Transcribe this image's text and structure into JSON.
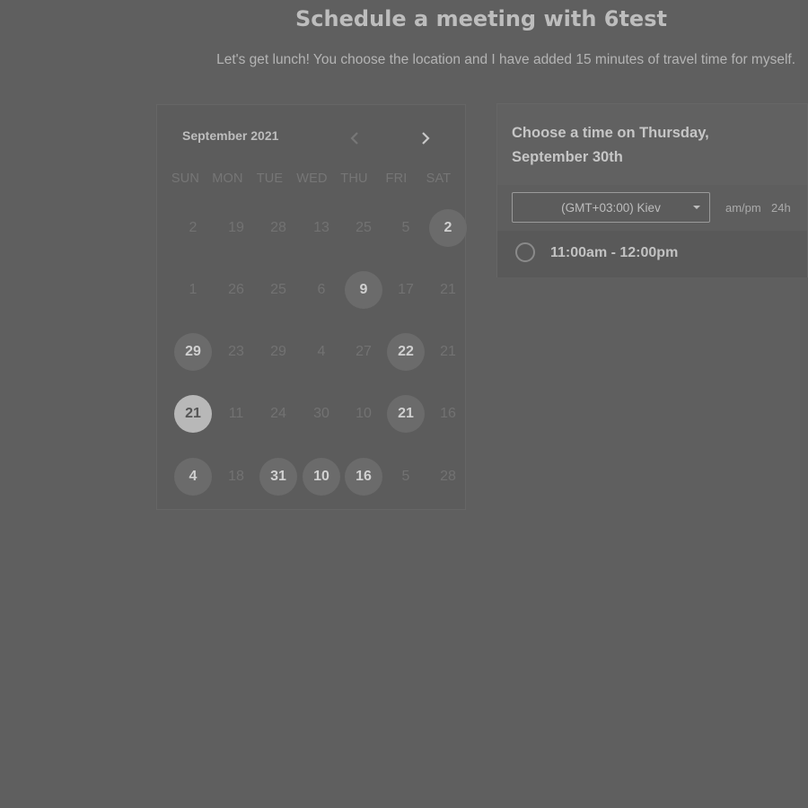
{
  "page": {
    "title": "Schedule a meeting with 6test",
    "subtitle": "Let's get lunch! You choose the location and I have added 15 minutes of travel time for myself."
  },
  "calendar": {
    "month_label": "September 2021",
    "prev_icon": "chevron-left-icon",
    "next_icon": "chevron-right-icon",
    "weekdays": [
      "SUN",
      "MON",
      "TUE",
      "WED",
      "THU",
      "FRI",
      "SAT"
    ],
    "weeks": [
      [
        {
          "label": "2",
          "state": "disabled"
        },
        {
          "label": "19",
          "state": "disabled"
        },
        {
          "label": "28",
          "state": "disabled"
        },
        {
          "label": "13",
          "state": "disabled"
        },
        {
          "label": "25",
          "state": "disabled"
        },
        {
          "label": "5",
          "state": "disabled"
        },
        {
          "label": "2",
          "state": "available"
        }
      ],
      [
        {
          "label": "1",
          "state": "disabled"
        },
        {
          "label": "26",
          "state": "disabled"
        },
        {
          "label": "25",
          "state": "disabled"
        },
        {
          "label": "6",
          "state": "disabled"
        },
        {
          "label": "9",
          "state": "available"
        },
        {
          "label": "17",
          "state": "disabled"
        },
        {
          "label": "21",
          "state": "disabled"
        }
      ],
      [
        {
          "label": "29",
          "state": "available"
        },
        {
          "label": "23",
          "state": "disabled"
        },
        {
          "label": "29",
          "state": "disabled"
        },
        {
          "label": "4",
          "state": "disabled"
        },
        {
          "label": "27",
          "state": "disabled"
        },
        {
          "label": "22",
          "state": "available"
        },
        {
          "label": "21",
          "state": "disabled"
        }
      ],
      [
        {
          "label": "21",
          "state": "selected"
        },
        {
          "label": "11",
          "state": "disabled"
        },
        {
          "label": "24",
          "state": "disabled"
        },
        {
          "label": "30",
          "state": "disabled"
        },
        {
          "label": "10",
          "state": "disabled"
        },
        {
          "label": "21",
          "state": "available"
        },
        {
          "label": "16",
          "state": "disabled"
        }
      ],
      [
        {
          "label": "4",
          "state": "available"
        },
        {
          "label": "18",
          "state": "disabled"
        },
        {
          "label": "31",
          "state": "available"
        },
        {
          "label": "10",
          "state": "available"
        },
        {
          "label": "16",
          "state": "available"
        },
        {
          "label": "5",
          "state": "disabled"
        },
        {
          "label": "28",
          "state": "disabled"
        }
      ]
    ]
  },
  "time_panel": {
    "heading": "Choose a time on Thursday, September 30th",
    "timezone": "(GMT+03:00) Kiev",
    "format_ampm": "am/pm",
    "format_24h": "24h",
    "slots": [
      {
        "label": "11:00am - 12:00pm"
      }
    ]
  },
  "colors": {
    "background": "#5f5f5f",
    "available_day": "#6b6b6b",
    "selected_day": "#b8b8b8"
  }
}
